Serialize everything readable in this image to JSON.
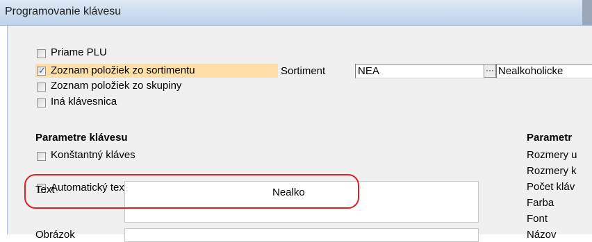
{
  "window": {
    "title": "Programovanie klávesu"
  },
  "source": {
    "options": [
      {
        "label": "Priame PLU",
        "checked": false
      },
      {
        "label": "Zoznam položiek zo sortimentu",
        "checked": true
      },
      {
        "label": "Zoznam položiek zo skupiny",
        "checked": false
      },
      {
        "label": "Iná klávesnica",
        "checked": false
      }
    ],
    "sortiment_label": "Sortiment",
    "sortiment_code": "NEA",
    "browse_label": "···",
    "sortiment_name": "Nealkoholicke"
  },
  "key_params": {
    "heading": "Parametre klávesu",
    "constant_key": {
      "label": "Konštantný kláves",
      "checked": false
    },
    "auto_text": {
      "label": "Automatický text",
      "checked": false
    },
    "text_label": "Text",
    "text_value": "Nealko",
    "next_label": "Obrázok"
  },
  "right_params": {
    "heading": "Parametr",
    "labels": [
      "Rozmery u",
      "Rozmery k",
      "Počet kláv",
      "Farba",
      "Font",
      "Názov"
    ]
  },
  "colors": {
    "highlight": "#ffdfa8",
    "annotation": "#e02020",
    "title_bar": "#c9dbef"
  }
}
